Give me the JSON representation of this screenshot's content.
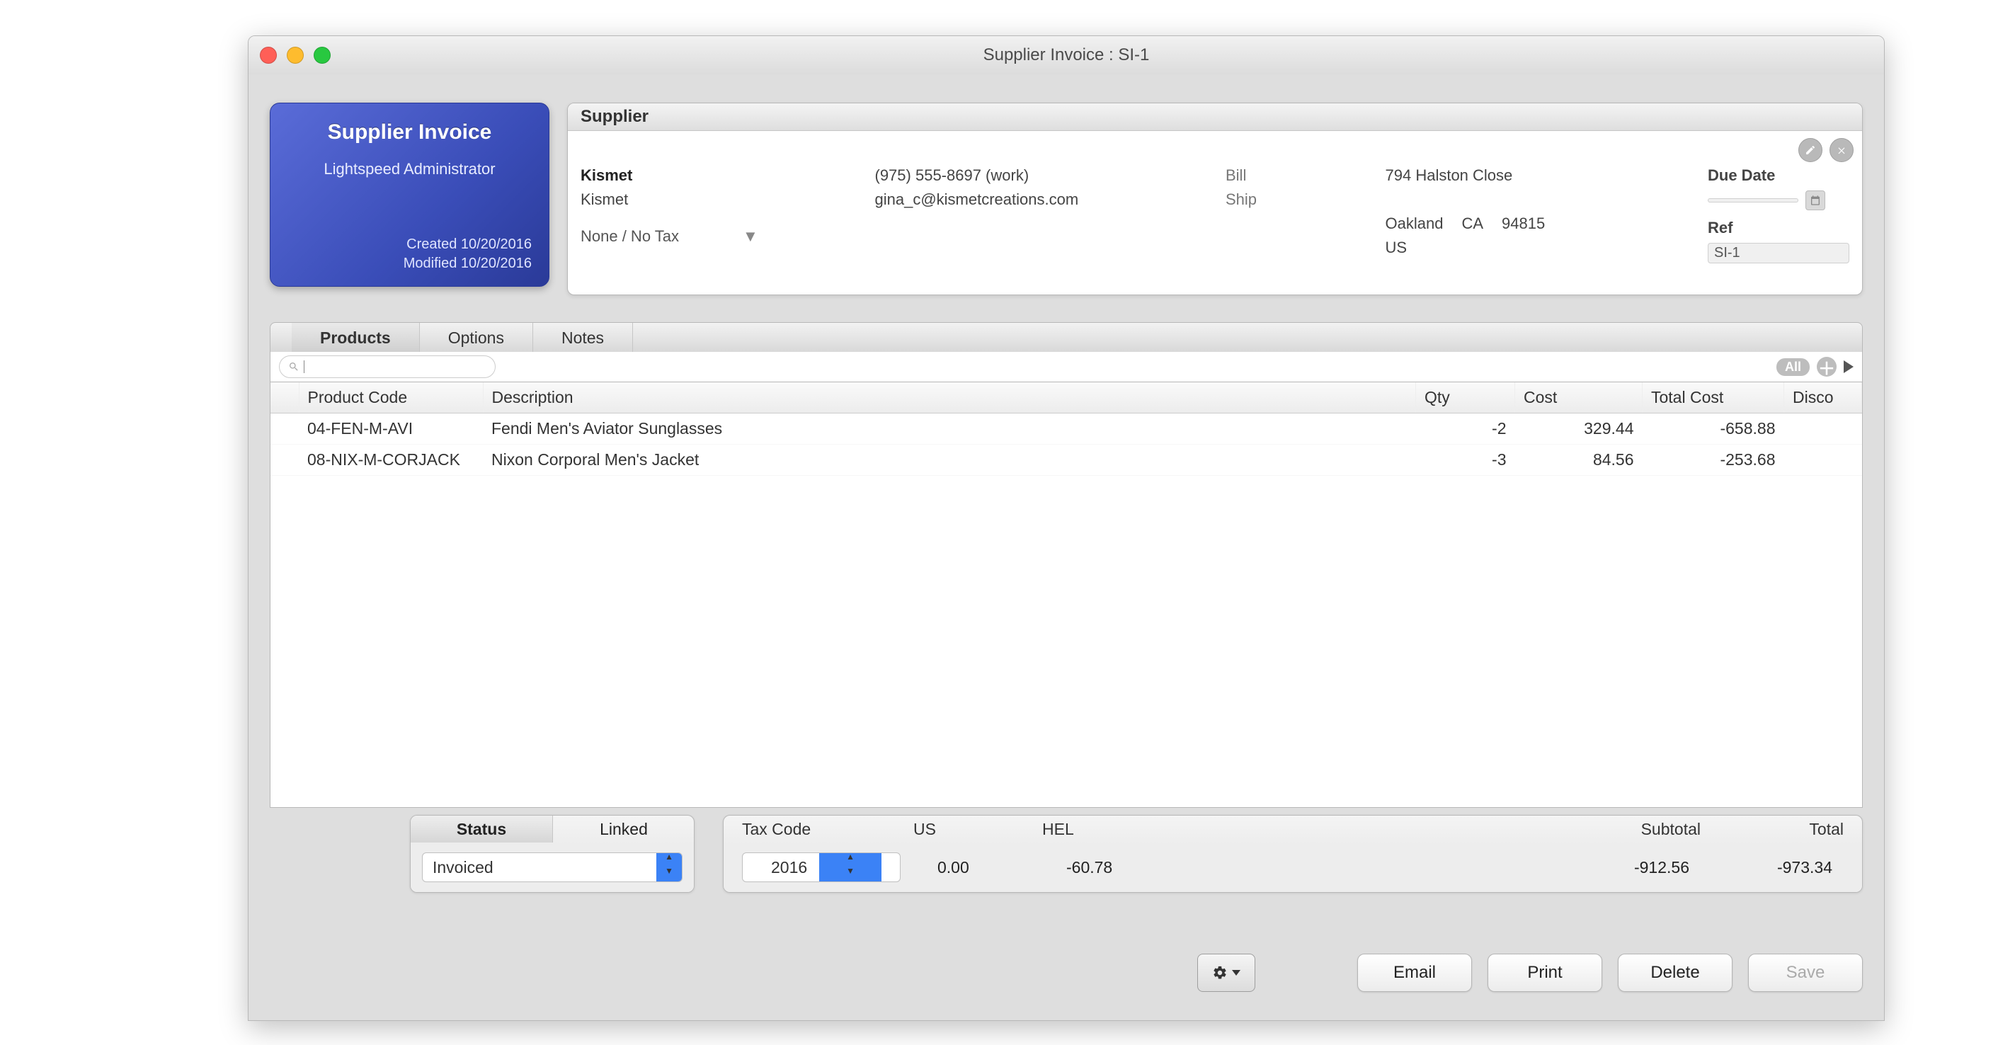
{
  "window": {
    "title": "Supplier Invoice : SI-1"
  },
  "sidecard": {
    "title": "Supplier Invoice",
    "user": "Lightspeed Administrator",
    "created_label": "Created",
    "created_value": "10/20/2016",
    "modified_label": "Modified",
    "modified_value": "10/20/2016"
  },
  "supplier_panel": {
    "header": "Supplier",
    "name1": "Kismet",
    "name2": "Kismet",
    "tax_line": "None / No Tax",
    "phone": "(975) 555-8697 (work)",
    "email": "gina_c@kismetcreations.com",
    "bill_label": "Bill",
    "ship_label": "Ship",
    "addr_line1": "794 Halston Close",
    "addr_city": "Oakland",
    "addr_state": "CA",
    "addr_zip": "94815",
    "addr_country": "US",
    "due_date_label": "Due Date",
    "due_date_value": "",
    "ref_label": "Ref",
    "ref_value": "SI-1"
  },
  "tabs": {
    "products": "Products",
    "options": "Options",
    "notes": "Notes"
  },
  "toolbar": {
    "search_placeholder": "",
    "all_pill": "All"
  },
  "columns": {
    "code": "Product Code",
    "desc": "Description",
    "qty": "Qty",
    "cost": "Cost",
    "total": "Total Cost",
    "disc": "Disco"
  },
  "rows": [
    {
      "code": "04-FEN-M-AVI",
      "desc": "Fendi Men's Aviator Sunglasses",
      "qty": "-2",
      "cost": "329.44",
      "total": "-658.88",
      "disc": ""
    },
    {
      "code": "08-NIX-M-CORJACK",
      "desc": "Nixon Corporal Men's Jacket",
      "qty": "-3",
      "cost": "84.56",
      "total": "-253.68",
      "disc": ""
    }
  ],
  "status_seg": {
    "tab_status": "Status",
    "tab_linked": "Linked",
    "value": "Invoiced"
  },
  "summary": {
    "tax_code_label": "Tax Code",
    "tax_code_value": "2016",
    "col_us": "US",
    "col_hel": "HEL",
    "col_subtotal": "Subtotal",
    "col_total": "Total",
    "us_value": "0.00",
    "hel_value": "-60.78",
    "subtotal_value": "-912.56",
    "total_value": "-973.34"
  },
  "actions": {
    "email": "Email",
    "print": "Print",
    "delete": "Delete",
    "save": "Save"
  }
}
